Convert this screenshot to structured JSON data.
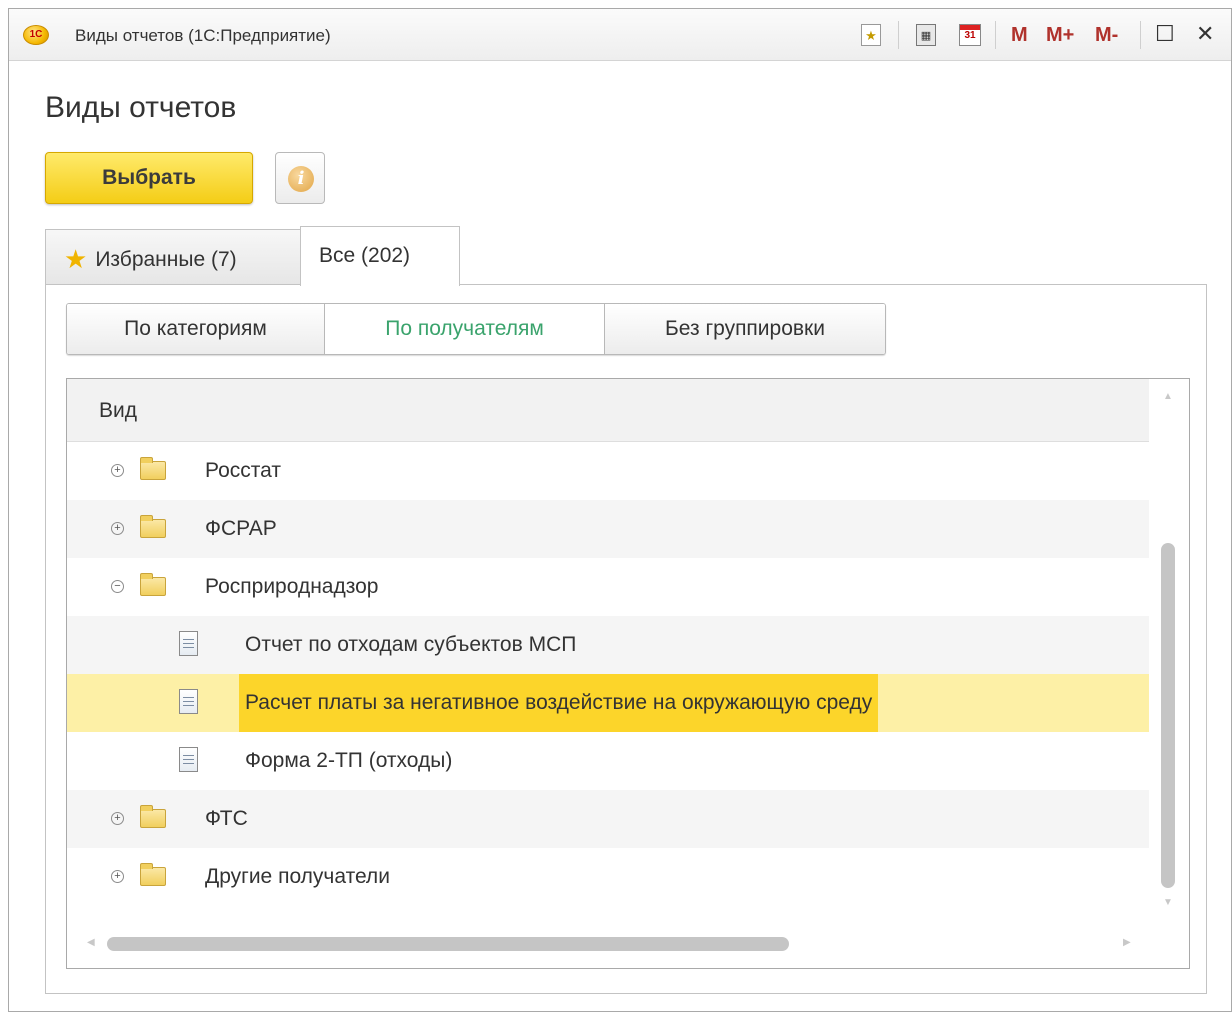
{
  "window": {
    "title": "Виды отчетов  (1С:Предприятие)",
    "app_logo": "1С",
    "toolbar": {
      "memory_buttons": [
        "M",
        "M+",
        "M-"
      ],
      "icons": [
        "favorites-icon",
        "calculator-icon",
        "calendar-icon"
      ],
      "calendar_label": "31",
      "maximize_label": "☐",
      "close_label": "✕"
    }
  },
  "page": {
    "title": "Виды отчетов",
    "select_button": "Выбрать",
    "info_button_glyph": "i"
  },
  "tabs": [
    {
      "label": "Избранные (7)",
      "icon": "star-icon",
      "active": false
    },
    {
      "label": "Все (202)",
      "active": true
    }
  ],
  "grouping": {
    "options": [
      "По категориям",
      "По получателям",
      "Без группировки"
    ],
    "selected": "По получателям"
  },
  "list": {
    "column_header": "Вид",
    "rows": [
      {
        "type": "folder",
        "label": "Росстат",
        "expanded": false,
        "level": 0
      },
      {
        "type": "folder",
        "label": "ФСРАР",
        "expanded": false,
        "level": 0
      },
      {
        "type": "folder",
        "label": "Росприроднадзор",
        "expanded": true,
        "level": 0
      },
      {
        "type": "report",
        "label": "Отчет по отходам субъектов МСП",
        "level": 1
      },
      {
        "type": "report",
        "label": "Расчет платы за негативное воздействие на окружающую среду",
        "level": 1,
        "selected": true
      },
      {
        "type": "report",
        "label": "Форма 2-ТП (отходы)",
        "level": 1
      },
      {
        "type": "folder",
        "label": "ФТС",
        "expanded": false,
        "level": 0
      },
      {
        "type": "folder",
        "label": "Другие получатели",
        "expanded": false,
        "level": 0
      }
    ]
  },
  "colors": {
    "accent_yellow": "#f4cd16",
    "selected_row": "#fdf0a6",
    "selected_cell": "#fcd52a",
    "active_switch_text": "#3aa36c",
    "memory_buttons": "#b0322c"
  }
}
